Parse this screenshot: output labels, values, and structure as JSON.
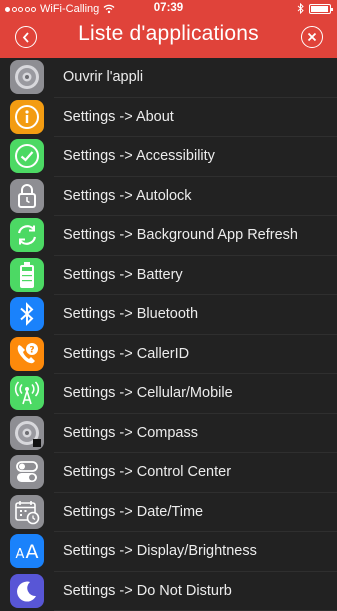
{
  "status_bar": {
    "carrier": "WiFi-Calling",
    "time": "07:39",
    "signal_dots_filled": 1,
    "signal_dots_total": 5
  },
  "nav": {
    "title": "Liste d'applications",
    "back_icon": "chevron-left-circle",
    "close_icon": "close-circle"
  },
  "colors": {
    "header": "#e0433a",
    "background": "#222222",
    "text": "#ececec"
  },
  "rows": [
    {
      "label": "Ouvrir l'appli",
      "icon": "settings-gear",
      "icon_color": "#8e8e93"
    },
    {
      "label": "Settings -> About",
      "icon": "info",
      "icon_color": "#f39c12"
    },
    {
      "label": "Settings -> Accessibility",
      "icon": "checkmark",
      "icon_color": "#4cd964"
    },
    {
      "label": "Settings -> Autolock",
      "icon": "lock",
      "icon_color": "#8e8e93"
    },
    {
      "label": "Settings -> Background App Refresh",
      "icon": "refresh",
      "icon_color": "#4cd964"
    },
    {
      "label": "Settings -> Battery",
      "icon": "battery",
      "icon_color": "#4cd964"
    },
    {
      "label": "Settings -> Bluetooth",
      "icon": "bluetooth",
      "icon_color": "#1a82fb"
    },
    {
      "label": "Settings -> CallerID",
      "icon": "phone-question",
      "icon_color": "#fd8a0b"
    },
    {
      "label": "Settings -> Cellular/Mobile",
      "icon": "antenna",
      "icon_color": "#4cd964"
    },
    {
      "label": "Settings -> Compass",
      "icon": "settings-gear",
      "icon_color": "#8e8e93"
    },
    {
      "label": "Settings -> Control Center",
      "icon": "toggles",
      "icon_color": "#8e8e93"
    },
    {
      "label": "Settings -> Date/Time",
      "icon": "calendar-clock",
      "icon_color": "#8e8e93"
    },
    {
      "label": "Settings -> Display/Brightness",
      "icon": "text-size",
      "icon_color": "#1a82fb"
    },
    {
      "label": "Settings -> Do Not Disturb",
      "icon": "moon",
      "icon_color": "#5856d6"
    }
  ]
}
